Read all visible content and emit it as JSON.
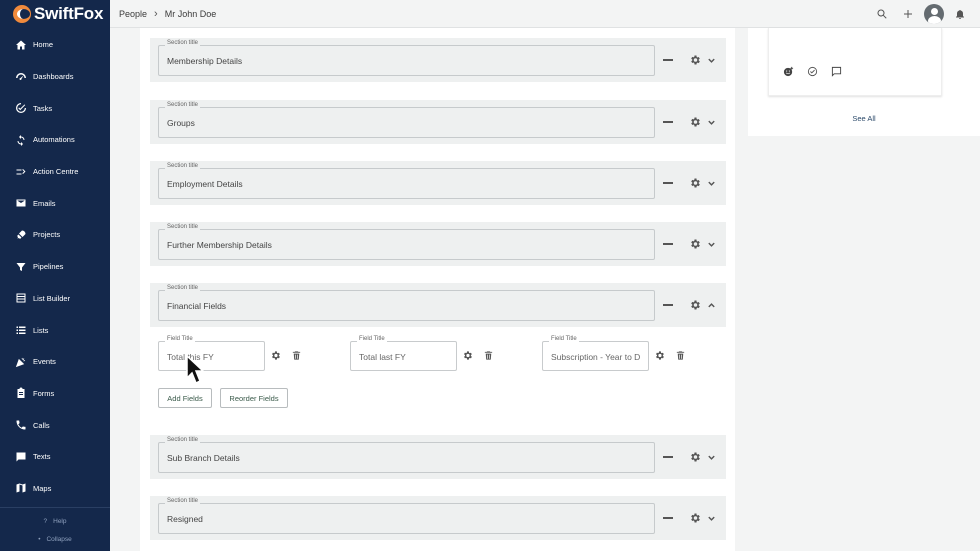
{
  "app": {
    "name": "SwiftFox"
  },
  "sidebar": {
    "items": [
      {
        "label": "Home",
        "icon": "home-icon"
      },
      {
        "label": "Dashboards",
        "icon": "dashboard-icon"
      },
      {
        "label": "Tasks",
        "icon": "check-circle-icon"
      },
      {
        "label": "Automations",
        "icon": "refresh-icon"
      },
      {
        "label": "Action Centre",
        "icon": "action-icon"
      },
      {
        "label": "Emails",
        "icon": "mail-icon"
      },
      {
        "label": "Projects",
        "icon": "rocket-icon"
      },
      {
        "label": "Pipelines",
        "icon": "filter-icon"
      },
      {
        "label": "List Builder",
        "icon": "list-builder-icon"
      },
      {
        "label": "Lists",
        "icon": "list-icon"
      },
      {
        "label": "Events",
        "icon": "party-icon"
      },
      {
        "label": "Forms",
        "icon": "clipboard-icon"
      },
      {
        "label": "Calls",
        "icon": "phone-icon"
      },
      {
        "label": "Texts",
        "icon": "chat-icon"
      },
      {
        "label": "Maps",
        "icon": "map-icon"
      }
    ],
    "help": "Help",
    "collapse": "Collapse"
  },
  "breadcrumb": {
    "parent": "People",
    "current": "Mr John Doe"
  },
  "sections": [
    {
      "label": "Section title",
      "value": "Membership Details"
    },
    {
      "label": "Section title",
      "value": "Groups"
    },
    {
      "label": "Section title",
      "value": "Employment Details"
    },
    {
      "label": "Section title",
      "value": "Further Membership Details"
    },
    {
      "label": "Section title",
      "value": "Financial Fields"
    },
    {
      "label": "Section title",
      "value": "Sub Branch Details"
    },
    {
      "label": "Section title",
      "value": "Resigned"
    }
  ],
  "financial_fields": [
    {
      "label": "Field Title",
      "value": "Total this FY"
    },
    {
      "label": "Field Title",
      "value": "Total last FY"
    },
    {
      "label": "Field Title",
      "value": "Subscription - Year to D"
    }
  ],
  "buttons": {
    "add_fields": "Add Fields",
    "reorder_fields": "Reorder Fields"
  },
  "right_panel": {
    "see_all": "See All"
  },
  "colors": {
    "sidebar": "#14284b",
    "accent": "#f08a3c",
    "section_bg": "#eef0f0"
  }
}
